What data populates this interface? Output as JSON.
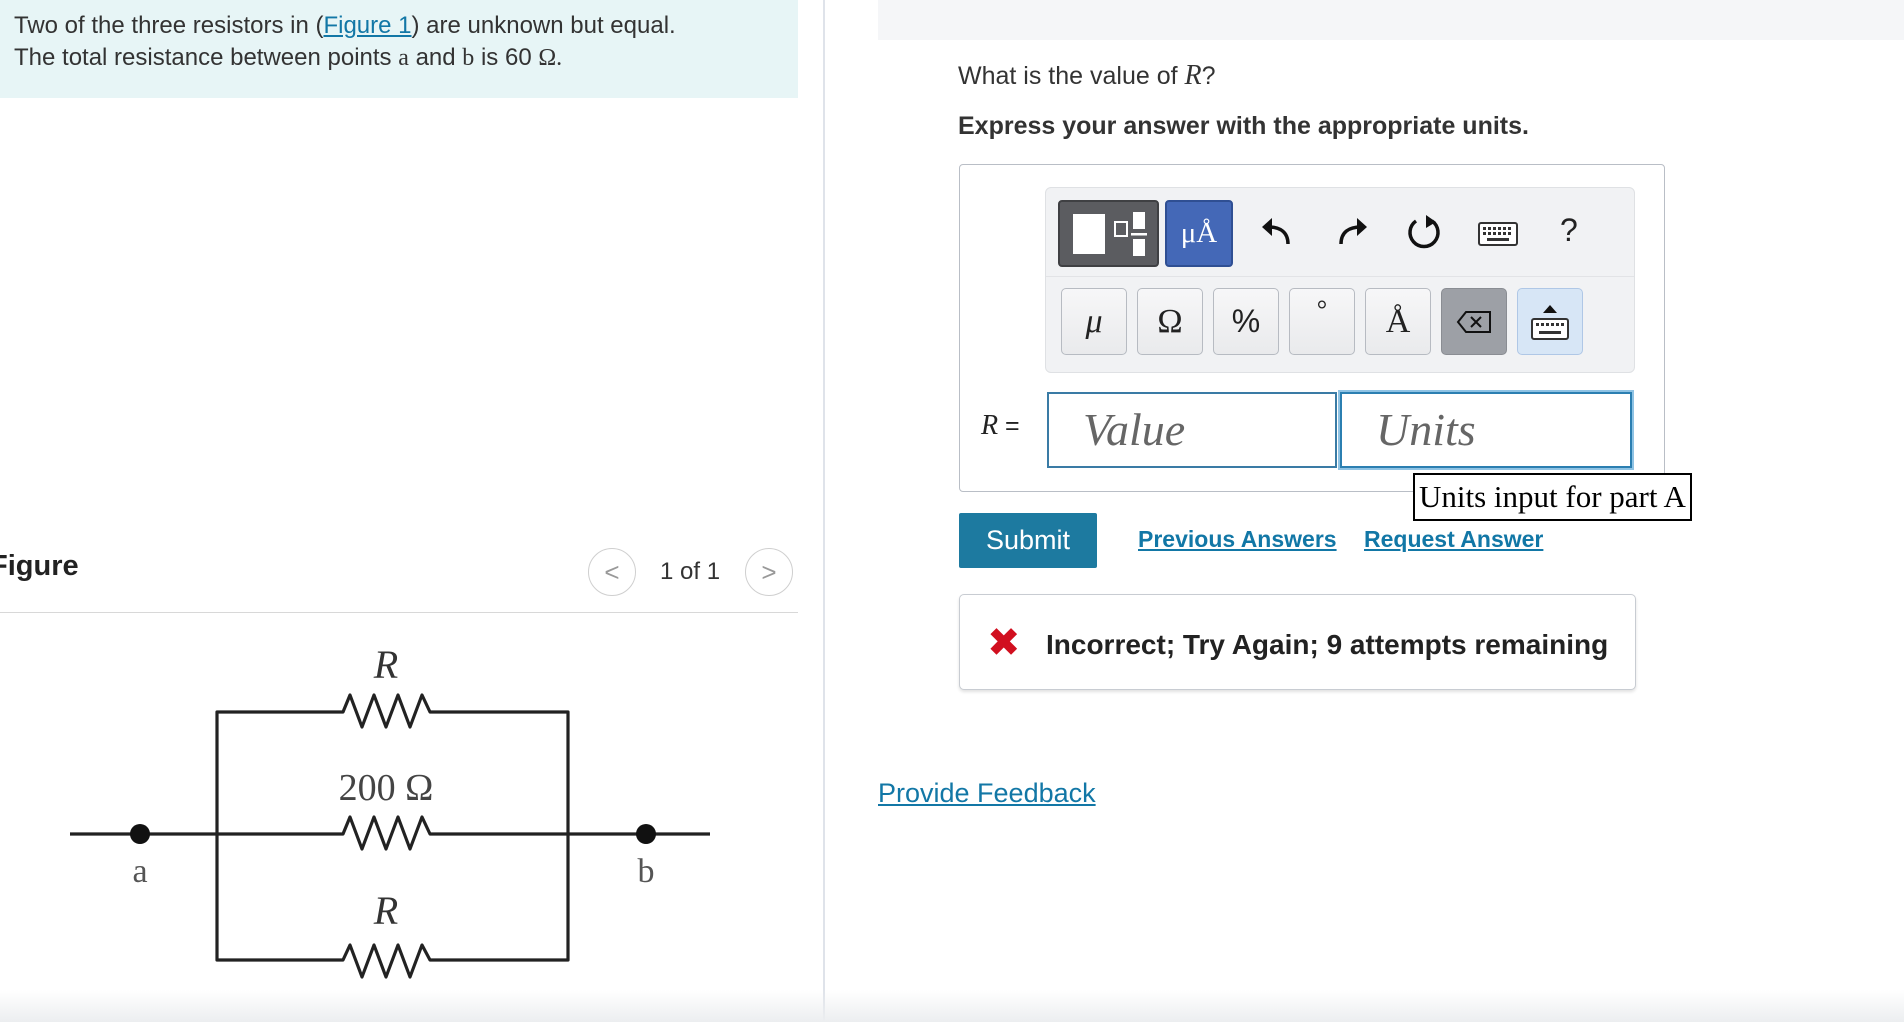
{
  "problem": {
    "line1_before": "Two of the three resistors in (",
    "figure_link": "Figure 1",
    "line1_after": ") are unknown but equal.",
    "line2_before": "The total resistance between points",
    "point_a": "a",
    "and_word": "and",
    "point_b": "b",
    "is_word": "is",
    "total_value": "60",
    "ohm_symbol": "Ω."
  },
  "figure": {
    "heading": "Figure",
    "counter": "1 of 1",
    "prev_symbol": "<",
    "next_symbol": ">",
    "top_resistor_label": "R",
    "middle_resistor_label": "200 Ω",
    "bottom_resistor_label": "R",
    "left_terminal": "a",
    "right_terminal": "b"
  },
  "question": {
    "prefix": "What is the value of",
    "variable": "R",
    "suffix": "?",
    "instruction": "Express your answer with the appropriate units."
  },
  "toolbar": {
    "units_button": "μÅ",
    "help": "?",
    "icons": [
      "template-icon",
      "undo-icon",
      "redo-icon",
      "reset-icon",
      "keyboard-icon"
    ],
    "unit_keys": [
      "μ",
      "Ω",
      "%",
      "°",
      "Å"
    ]
  },
  "answer": {
    "variable_label": "R =",
    "value_placeholder": "Value",
    "units_placeholder": "Units",
    "units_tooltip": "Units input for part A"
  },
  "actions": {
    "submit": "Submit",
    "previous_answers": "Previous Answers",
    "request_answer": "Request Answer"
  },
  "feedback": {
    "icon": "✖",
    "message": "Incorrect; Try Again; 9 attempts remaining"
  },
  "provide_feedback": "Provide Feedback",
  "colors": {
    "accent": "#1d7aa0",
    "link": "#1277a6",
    "error": "#d10f1f",
    "problem_bg": "#e7f5f6",
    "units_button": "#4468b7"
  }
}
